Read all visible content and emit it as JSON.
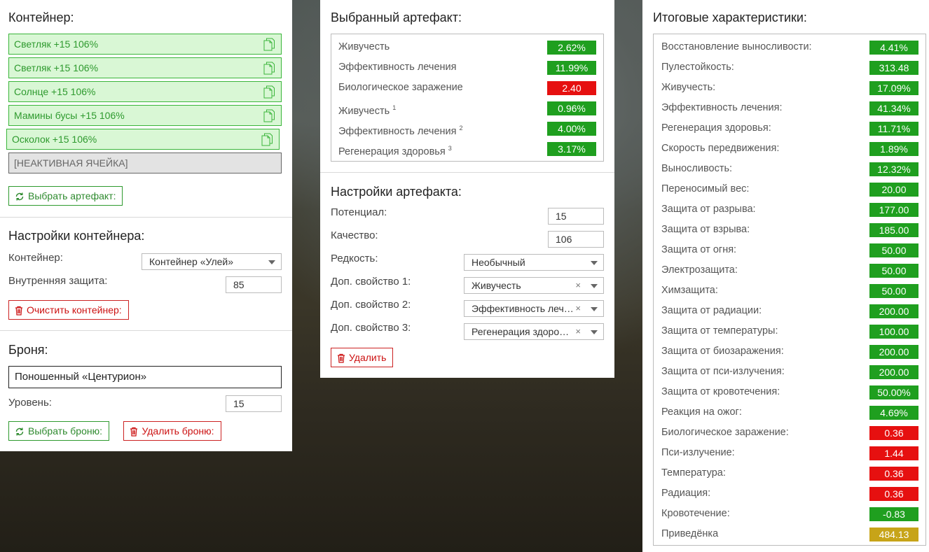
{
  "container_panel": {
    "title": "Контейнер:",
    "slots": [
      {
        "label": "Светляк +15 106%"
      },
      {
        "label": "Светляк +15 106%"
      },
      {
        "label": "Солнце +15 106%"
      },
      {
        "label": "Мамины бусы +15 106%"
      },
      {
        "label": "Осколок +15 106%"
      }
    ],
    "inactive_slot": "[НЕАКТИВНАЯ ЯЧЕЙКА]",
    "choose_artifact_label": "Выбрать артефакт:"
  },
  "container_settings": {
    "title": "Настройки контейнера:",
    "container_label": "Контейнер:",
    "container_value": "Контейнер «Улей»",
    "inner_protection_label": "Внутренняя защита:",
    "inner_protection_value": "85",
    "clear_label": "Очистить контейнер:"
  },
  "armor": {
    "title": "Броня:",
    "name": "Поношенный «Центурион»",
    "level_label": "Уровень:",
    "level_value": "15",
    "choose_label": "Выбрать броню:",
    "delete_label": "Удалить броню:"
  },
  "selected_artifact": {
    "title": "Выбранный артефакт:",
    "props": [
      {
        "name": "Живучесть",
        "sup": "",
        "value": "2.62%",
        "status": "g"
      },
      {
        "name": "Эффективность лечения",
        "sup": "",
        "value": "11.99%",
        "status": "g"
      },
      {
        "name": "Биологическое заражение",
        "sup": "",
        "value": "2.40",
        "status": "r"
      },
      {
        "name": "Живучесть",
        "sup": "1",
        "value": "0.96%",
        "status": "g"
      },
      {
        "name": "Эффективность лечения",
        "sup": "2",
        "value": "4.00%",
        "status": "g"
      },
      {
        "name": "Регенерация здоровья",
        "sup": "3",
        "value": "3.17%",
        "status": "g"
      }
    ]
  },
  "artifact_settings": {
    "title": "Настройки артефакта:",
    "potential_label": "Потенциал:",
    "potential_value": "15",
    "quality_label": "Качество:",
    "quality_value": "106",
    "rarity_label": "Редкость:",
    "rarity_value": "Необычный",
    "extra1_label": "Доп. свойство 1:",
    "extra1_value": "Живучесть",
    "extra2_label": "Доп. свойство 2:",
    "extra2_value": "Эффективность лечения",
    "extra3_label": "Доп. свойство 3:",
    "extra3_value": "Регенерация здоровья",
    "clear_symbol": "×",
    "delete_label": "Удалить"
  },
  "totals": {
    "title": "Итоговые характеристики:",
    "props": [
      {
        "name": "Восстановление выносливости:",
        "value": "4.41%",
        "status": "g"
      },
      {
        "name": "Пулестойкость:",
        "value": "313.48",
        "status": "g"
      },
      {
        "name": "Живучесть:",
        "value": "17.09%",
        "status": "g"
      },
      {
        "name": "Эффективность лечения:",
        "value": "41.34%",
        "status": "g"
      },
      {
        "name": "Регенерация здоровья:",
        "value": "11.71%",
        "status": "g"
      },
      {
        "name": "Скорость передвижения:",
        "value": "1.89%",
        "status": "g"
      },
      {
        "name": "Выносливость:",
        "value": "12.32%",
        "status": "g"
      },
      {
        "name": "Переносимый вес:",
        "value": "20.00",
        "status": "g"
      },
      {
        "name": "Защита от разрыва:",
        "value": "177.00",
        "status": "g"
      },
      {
        "name": "Защита от взрыва:",
        "value": "185.00",
        "status": "g"
      },
      {
        "name": "Защита от огня:",
        "value": "50.00",
        "status": "g"
      },
      {
        "name": "Электрозащита:",
        "value": "50.00",
        "status": "g"
      },
      {
        "name": "Химзащита:",
        "value": "50.00",
        "status": "g"
      },
      {
        "name": "Защита от радиации:",
        "value": "200.00",
        "status": "g"
      },
      {
        "name": "Защита от температуры:",
        "value": "100.00",
        "status": "g"
      },
      {
        "name": "Защита от биозаражения:",
        "value": "200.00",
        "status": "g"
      },
      {
        "name": "Защита от пси-излучения:",
        "value": "200.00",
        "status": "g"
      },
      {
        "name": "Защита от кровотечения:",
        "value": "50.00%",
        "status": "g"
      },
      {
        "name": "Реакция на ожог:",
        "value": "4.69%",
        "status": "g"
      },
      {
        "name": "Биологическое заражение:",
        "value": "0.36",
        "status": "r"
      },
      {
        "name": "Пси-излучение:",
        "value": "1.44",
        "status": "r"
      },
      {
        "name": "Температура:",
        "value": "0.36",
        "status": "r"
      },
      {
        "name": "Радиация:",
        "value": "0.36",
        "status": "r"
      },
      {
        "name": "Кровотечение:",
        "value": "-0.83",
        "status": "g"
      },
      {
        "name": "Приведёнка",
        "value": "484.13",
        "status": "y"
      }
    ]
  },
  "colors": {
    "good": "#1f9f1f",
    "bad": "#e61010",
    "neutral": "#c7a418",
    "accent": "#2e9a2e"
  }
}
